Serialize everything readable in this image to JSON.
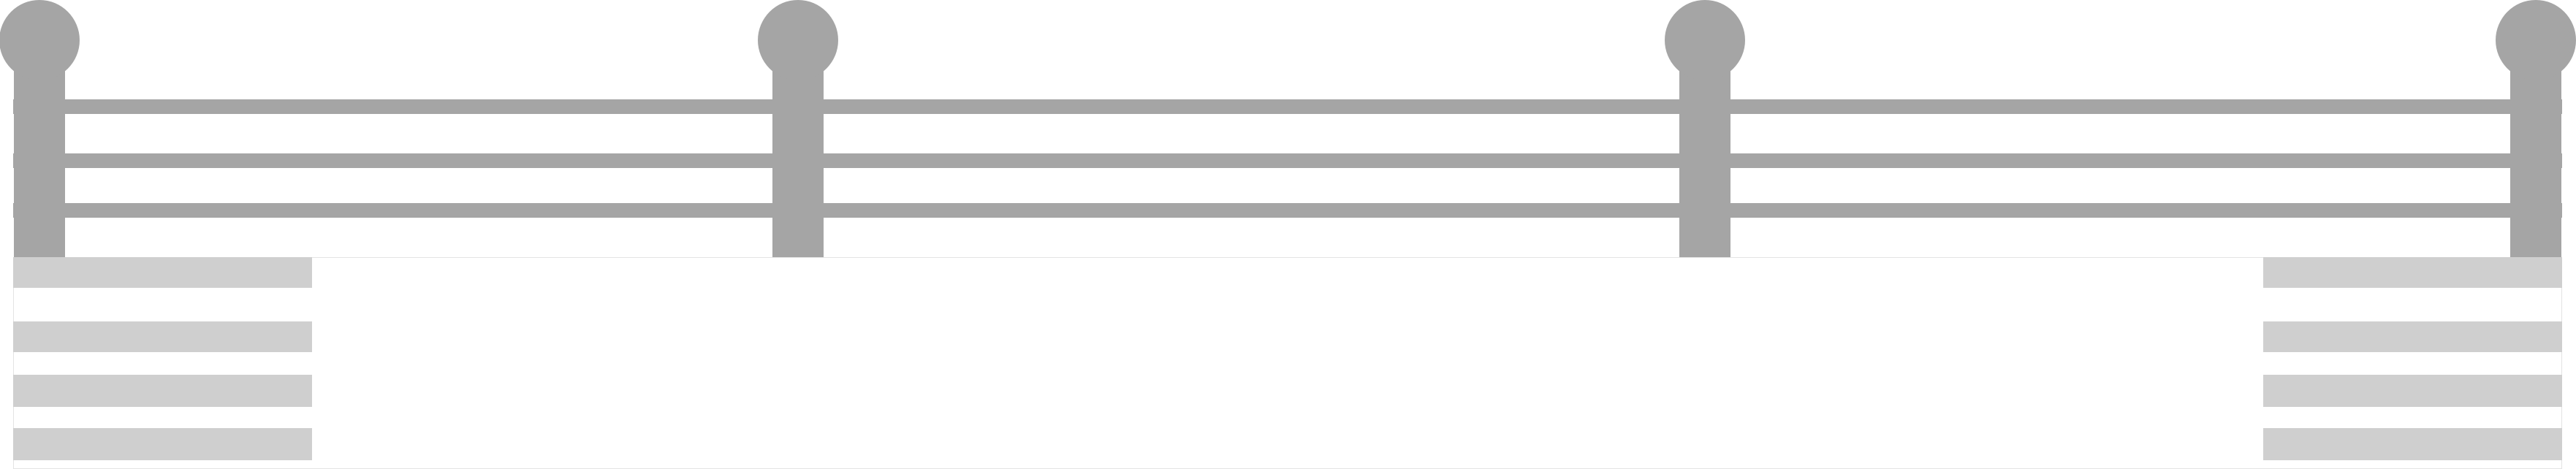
{
  "colors": {
    "background": "#ffffff",
    "fence": "#a5a5a5",
    "stripes": "#cfcfcf",
    "banner_fill": "#ffffff",
    "banner_border": "#e3e3e3"
  },
  "fence": {
    "post_count": 4,
    "rail_count": 3
  },
  "banner": {
    "stripes_per_side": 4
  }
}
